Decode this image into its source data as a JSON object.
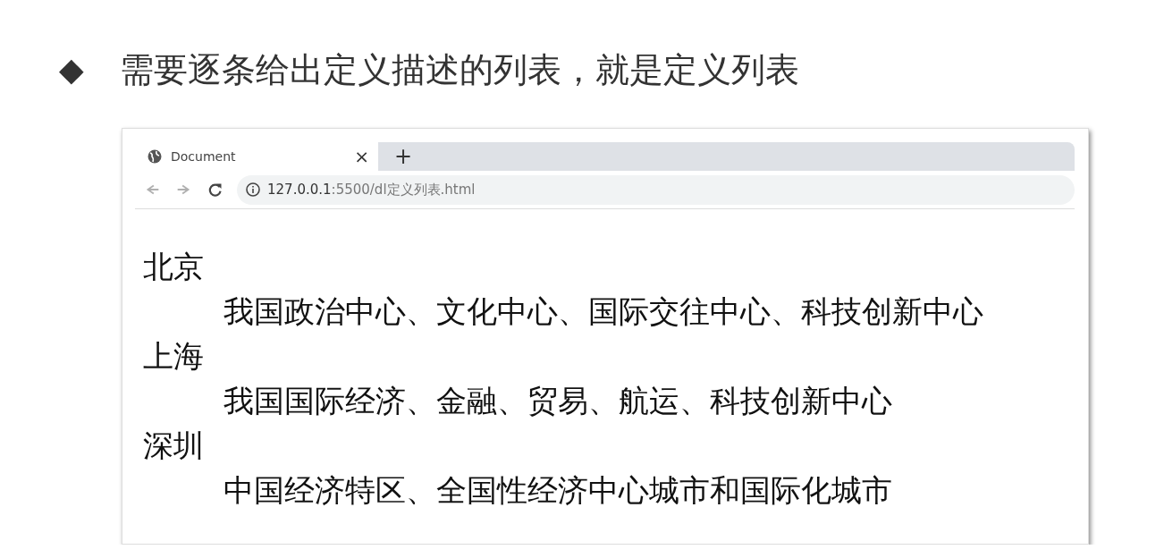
{
  "heading": {
    "bullet": "◆",
    "text": "需要逐条给出定义描述的列表，就是定义列表"
  },
  "browser": {
    "tabs": [
      {
        "title": "Document",
        "selected": true,
        "close": "×"
      }
    ],
    "new_tab": "+",
    "nav": [
      {
        "kind": "back",
        "disabled": true
      },
      {
        "kind": "forward",
        "disabled": true
      },
      {
        "kind": "reload",
        "disabled": false
      }
    ],
    "url_host": "127.0.0.1",
    "url_path": ":5500/dl定义列表.html"
  },
  "definitions": [
    {
      "term": "北京",
      "description": "我国政治中心、文化中心、国际交往中心、科技创新中心"
    },
    {
      "term": "上海",
      "description": "我国国际经济、金融、贸易、航运、科技创新中心"
    },
    {
      "term": "深圳",
      "description": "中国经济特区、全国性经济中心城市和国际化城市"
    }
  ]
}
